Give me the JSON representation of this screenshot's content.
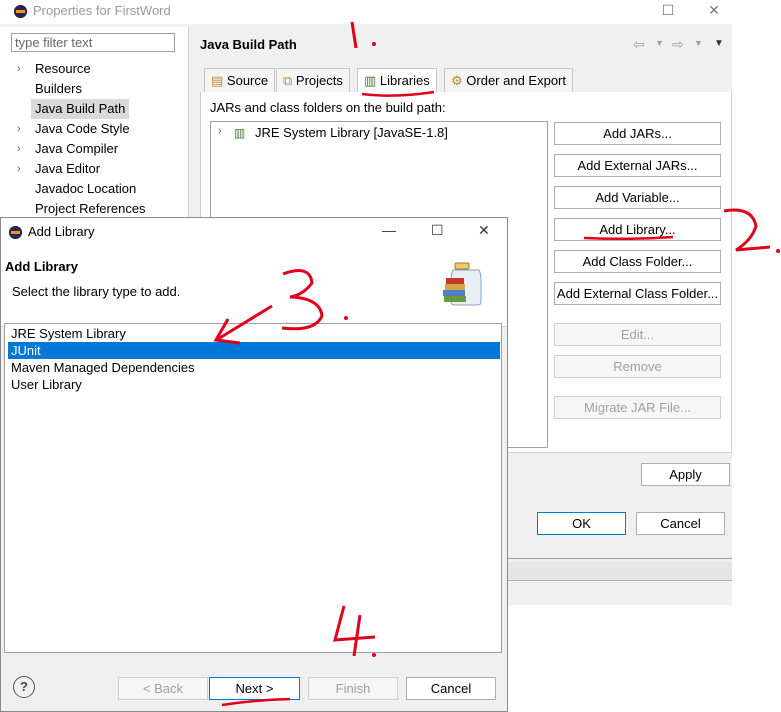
{
  "props_window": {
    "title": "Properties for FirstWord",
    "filter_placeholder": "type filter text",
    "tree": [
      {
        "label": "Resource",
        "expandable": true
      },
      {
        "label": "Builders",
        "expandable": false
      },
      {
        "label": "Java Build Path",
        "expandable": false,
        "selected": true
      },
      {
        "label": "Java Code Style",
        "expandable": true
      },
      {
        "label": "Java Compiler",
        "expandable": true
      },
      {
        "label": "Java Editor",
        "expandable": true
      },
      {
        "label": "Javadoc Location",
        "expandable": false
      },
      {
        "label": "Project References",
        "expandable": false
      }
    ],
    "page_title": "Java Build Path",
    "tabs": [
      "Source",
      "Projects",
      "Libraries",
      "Order and Export"
    ],
    "active_tab": "Libraries",
    "build_path_label": "JARs and class folders on the build path:",
    "build_entries": [
      "JRE System Library [JavaSE-1.8]"
    ],
    "buttons": {
      "add_jars": "Add JARs...",
      "add_external_jars": "Add External JARs...",
      "add_variable": "Add Variable...",
      "add_library": "Add Library...",
      "add_class_folder": "Add Class Folder...",
      "add_external_class_folder": "Add External Class Folder...",
      "edit": "Edit...",
      "remove": "Remove",
      "migrate": "Migrate JAR File...",
      "apply": "Apply",
      "ok": "OK",
      "cancel": "Cancel"
    }
  },
  "add_library_dialog": {
    "title": "Add Library",
    "header_title": "Add Library",
    "header_desc": "Select the library type to add.",
    "libraries": [
      "JRE System Library",
      "JUnit",
      "Maven Managed Dependencies",
      "User Library"
    ],
    "selected": "JUnit",
    "buttons": {
      "back": "< Back",
      "next": "Next >",
      "finish": "Finish",
      "cancel": "Cancel",
      "help": "?"
    }
  },
  "annotations": [
    "1.",
    "2.",
    "3.",
    "4."
  ],
  "colors": {
    "selection": "#0078d7",
    "annotation_red": "#e0001b"
  }
}
